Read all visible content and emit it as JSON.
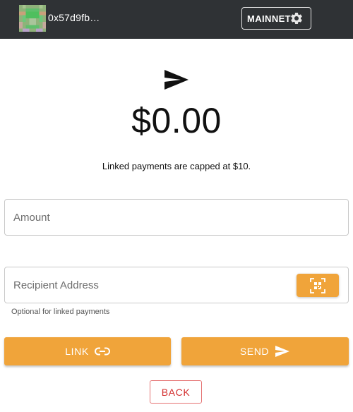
{
  "header": {
    "address": "0x57d9fb…",
    "network_label": "MAINNET",
    "avatar_icon": "identicon-avatar",
    "settings_icon": "gear-icon",
    "background_color": "#2f3235"
  },
  "main": {
    "top_icon": "send-arrow-icon",
    "balance": "$0.00",
    "cap_note": "Linked payments are capped at $10."
  },
  "form": {
    "amount_placeholder": "Amount",
    "recipient_placeholder": "Recipient Address",
    "recipient_helper": "Optional for linked payments",
    "qr_icon": "qr-scan-icon"
  },
  "actions": {
    "link_label": "LINK",
    "link_icon": "link-icon",
    "send_label": "SEND",
    "send_icon": "send-arrow-icon",
    "back_label": "BACK"
  },
  "colors": {
    "accent": "#f0a43a",
    "back_red": "#d32f2f"
  }
}
